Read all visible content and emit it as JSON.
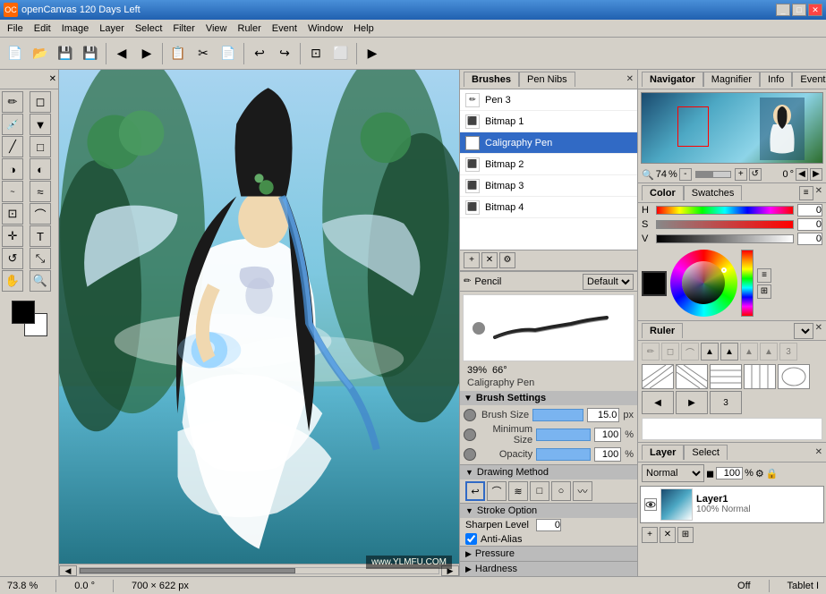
{
  "titleBar": {
    "icon": "OC",
    "title": "openCanvas 120 Days Left",
    "controls": [
      "_",
      "□",
      "✕"
    ]
  },
  "menuBar": {
    "items": [
      "File",
      "Edit",
      "Image",
      "Layer",
      "Select",
      "Filter",
      "View",
      "Ruler",
      "Event",
      "Window",
      "Help"
    ]
  },
  "toolbar": {
    "buttons": [
      "📂",
      "💾",
      "⬛",
      "◀",
      "▶",
      "📋",
      "✂",
      "📄",
      "🔙",
      "🔄",
      "⬜",
      "⬛",
      "▶"
    ]
  },
  "toolsPanel": {
    "tools": [
      {
        "name": "pencil-tool",
        "icon": "✏",
        "active": false
      },
      {
        "name": "eraser-tool",
        "icon": "◻",
        "active": false
      },
      {
        "name": "eyedropper-tool",
        "icon": "💉",
        "active": false
      },
      {
        "name": "fill-tool",
        "icon": "▼",
        "active": false
      },
      {
        "name": "line-tool",
        "icon": "╱",
        "active": false
      },
      {
        "name": "shape-tool",
        "icon": "□",
        "active": false
      },
      {
        "name": "dodge-tool",
        "icon": "◑",
        "active": false
      },
      {
        "name": "burn-tool",
        "icon": "◐",
        "active": false
      },
      {
        "name": "smudge-tool",
        "icon": "~",
        "active": false
      },
      {
        "name": "blur-tool",
        "icon": "≈",
        "active": false
      },
      {
        "name": "marquee-tool",
        "icon": "⊡",
        "active": false
      },
      {
        "name": "lasso-tool",
        "icon": "⌒",
        "active": false
      },
      {
        "name": "move-tool",
        "icon": "✛",
        "active": false
      },
      {
        "name": "text-tool",
        "icon": "T",
        "active": false
      },
      {
        "name": "rotate-tool",
        "icon": "↺",
        "active": false
      },
      {
        "name": "transform-tool",
        "icon": "⤡",
        "active": false
      },
      {
        "name": "hand-tool",
        "icon": "✋",
        "active": false
      },
      {
        "name": "zoom-tool",
        "icon": "🔍",
        "active": false
      }
    ]
  },
  "brushesPanel": {
    "title": "Brushes",
    "tabs": [
      {
        "label": "Brushes",
        "active": true
      },
      {
        "label": "Pen Nibs",
        "active": false
      }
    ],
    "items": [
      {
        "name": "Pen 3",
        "selected": false
      },
      {
        "name": "Bitmap 1",
        "selected": false
      },
      {
        "name": "Caligraphy Pen",
        "selected": true
      },
      {
        "name": "Bitmap 2",
        "selected": false
      },
      {
        "name": "Bitmap 3",
        "selected": false
      },
      {
        "name": "Bitmap 4",
        "selected": false
      }
    ]
  },
  "pencilSection": {
    "title": "Pencil",
    "opacity_pct": "39%",
    "size_deg": "66°",
    "brush_name": "Caligraphy Pen"
  },
  "brushSettings": {
    "title": "Brush Settings",
    "brush_size_label": "Brush Size",
    "brush_size_value": "15.0",
    "brush_size_unit": "px",
    "min_size_label": "Minimum Size",
    "min_size_value": "100",
    "min_size_unit": "%",
    "opacity_label": "Opacity",
    "opacity_value": "100",
    "opacity_unit": "%"
  },
  "drawingMethod": {
    "title": "Drawing Method",
    "buttons": [
      "↩",
      "⌒",
      "≋",
      "□",
      "○",
      "〰"
    ]
  },
  "strokeOption": {
    "title": "Stroke Option",
    "sharpen_label": "Sharpen Level",
    "sharpen_value": "0",
    "antialias_label": "Anti-Alias",
    "antialias_checked": true
  },
  "pressureSection": {
    "title": "Pressure"
  },
  "hardnessSection": {
    "title": "Hardness"
  },
  "navigatorPanel": {
    "tabs": [
      "Navigator",
      "Magnifier",
      "Info",
      "Event"
    ],
    "zoom_value": "74",
    "zoom_unit": "%",
    "rotation_value": "0",
    "rotation_unit": "°"
  },
  "colorPanel": {
    "tabs": [
      "Color",
      "Swatches"
    ],
    "h_label": "H",
    "h_value": "0",
    "s_label": "S",
    "s_value": "0",
    "v_label": "V",
    "v_value": "0"
  },
  "rulerPanel": {
    "title": "Ruler",
    "dropdown_value": ""
  },
  "layerPanel": {
    "tabs": [
      "Layer",
      "Select"
    ],
    "blend_mode": "Normal",
    "opacity_value": "100",
    "opacity_unit": "%",
    "layers": [
      {
        "name": "Layer1",
        "mode": "100% Normal",
        "visible": true
      }
    ]
  },
  "statusBar": {
    "zoom": "73.8 %",
    "rotation": "0.0 °",
    "dimensions": "700 × 622 px",
    "tablet": "Off",
    "tablet_label": "Tablet I"
  }
}
